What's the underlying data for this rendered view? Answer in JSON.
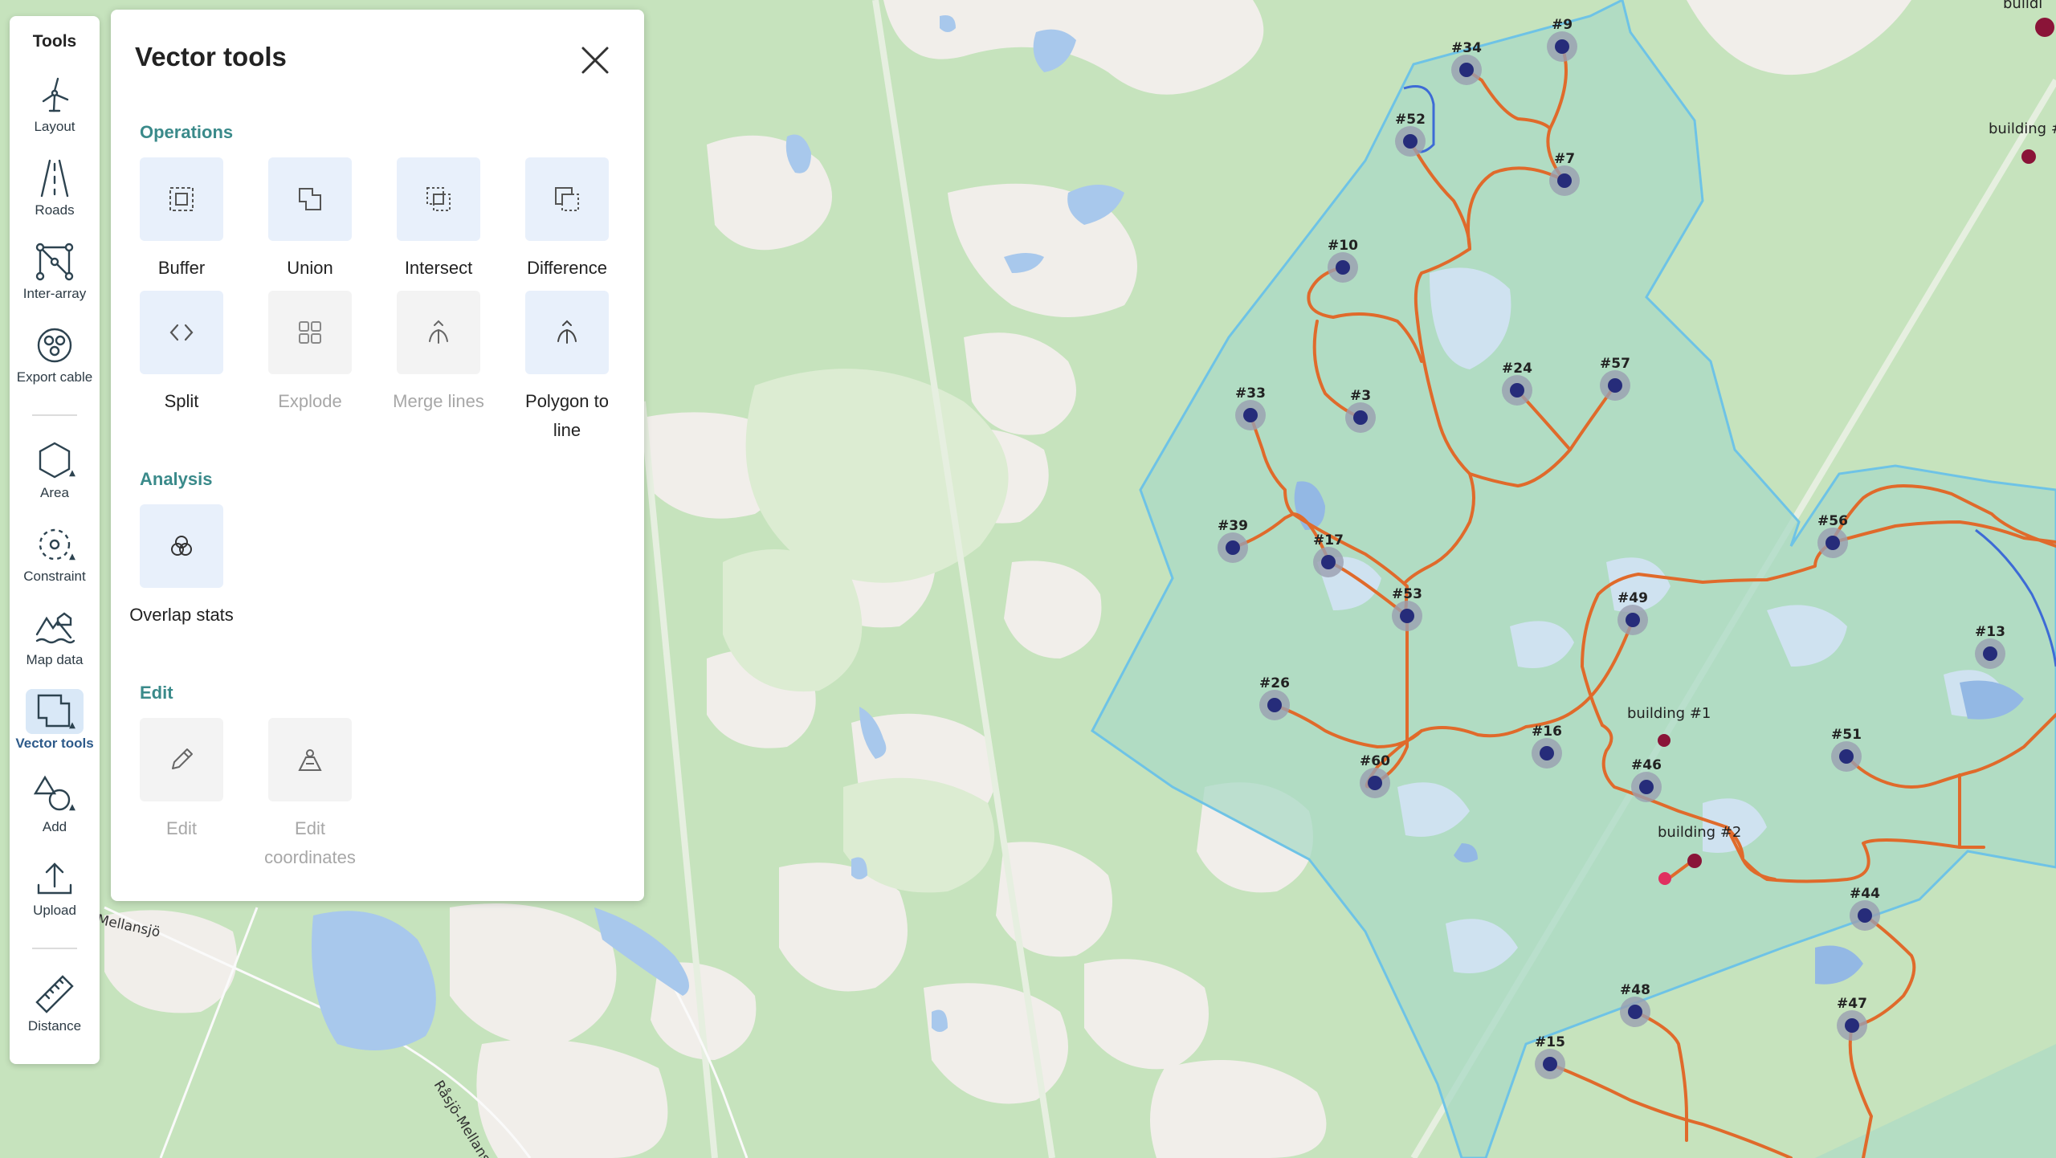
{
  "toolbar": {
    "title": "Tools",
    "items": [
      {
        "label": "Layout",
        "icon": "wind-turbine-icon"
      },
      {
        "label": "Roads",
        "icon": "road-icon"
      },
      {
        "label": "Inter-array",
        "icon": "network-icon"
      },
      {
        "label": "Export cable",
        "icon": "cable-icon"
      },
      {
        "label": "Area",
        "icon": "hexagon-icon"
      },
      {
        "label": "Constraint",
        "icon": "constraint-icon"
      },
      {
        "label": "Map data",
        "icon": "map-data-icon"
      },
      {
        "label": "Vector tools",
        "icon": "vector-tools-icon",
        "active": true
      },
      {
        "label": "Add",
        "icon": "shapes-icon"
      },
      {
        "label": "Upload",
        "icon": "upload-icon"
      },
      {
        "label": "Distance",
        "icon": "ruler-icon"
      }
    ]
  },
  "panel": {
    "title": "Vector tools",
    "sections": {
      "operations": "Operations",
      "analysis": "Analysis",
      "edit": "Edit"
    },
    "tools": {
      "buffer": "Buffer",
      "union": "Union",
      "intersect": "Intersect",
      "difference": "Difference",
      "split": "Split",
      "explode": "Explode",
      "merge_lines": "Merge lines",
      "polygon_to_line": "Polygon to line",
      "overlap_stats": "Overlap stats",
      "edit": "Edit",
      "edit_coordinates": "Edit coordinates"
    }
  },
  "map": {
    "place_labels": [
      "Mellansjö",
      "Råsjö-Mellansjö"
    ],
    "turbines": [
      "#9",
      "#34",
      "#52",
      "#7",
      "#10",
      "#24",
      "#57",
      "#33",
      "#3",
      "#39",
      "#17",
      "#53",
      "#56",
      "#49",
      "#13",
      "#26",
      "#16",
      "#46",
      "#51",
      "#60",
      "#44",
      "#48",
      "#47",
      "#15"
    ],
    "buildings": [
      "building #1",
      "building #2",
      "building #",
      "buildi"
    ],
    "colors": {
      "land": "#c6e3bd",
      "water": "#a8c8ec",
      "area_fill": "#a9d9c6",
      "area_stroke": "#6ec3e6",
      "road": "#e06a2b",
      "turbine": "#262c7a",
      "building": "#8a1438"
    }
  }
}
